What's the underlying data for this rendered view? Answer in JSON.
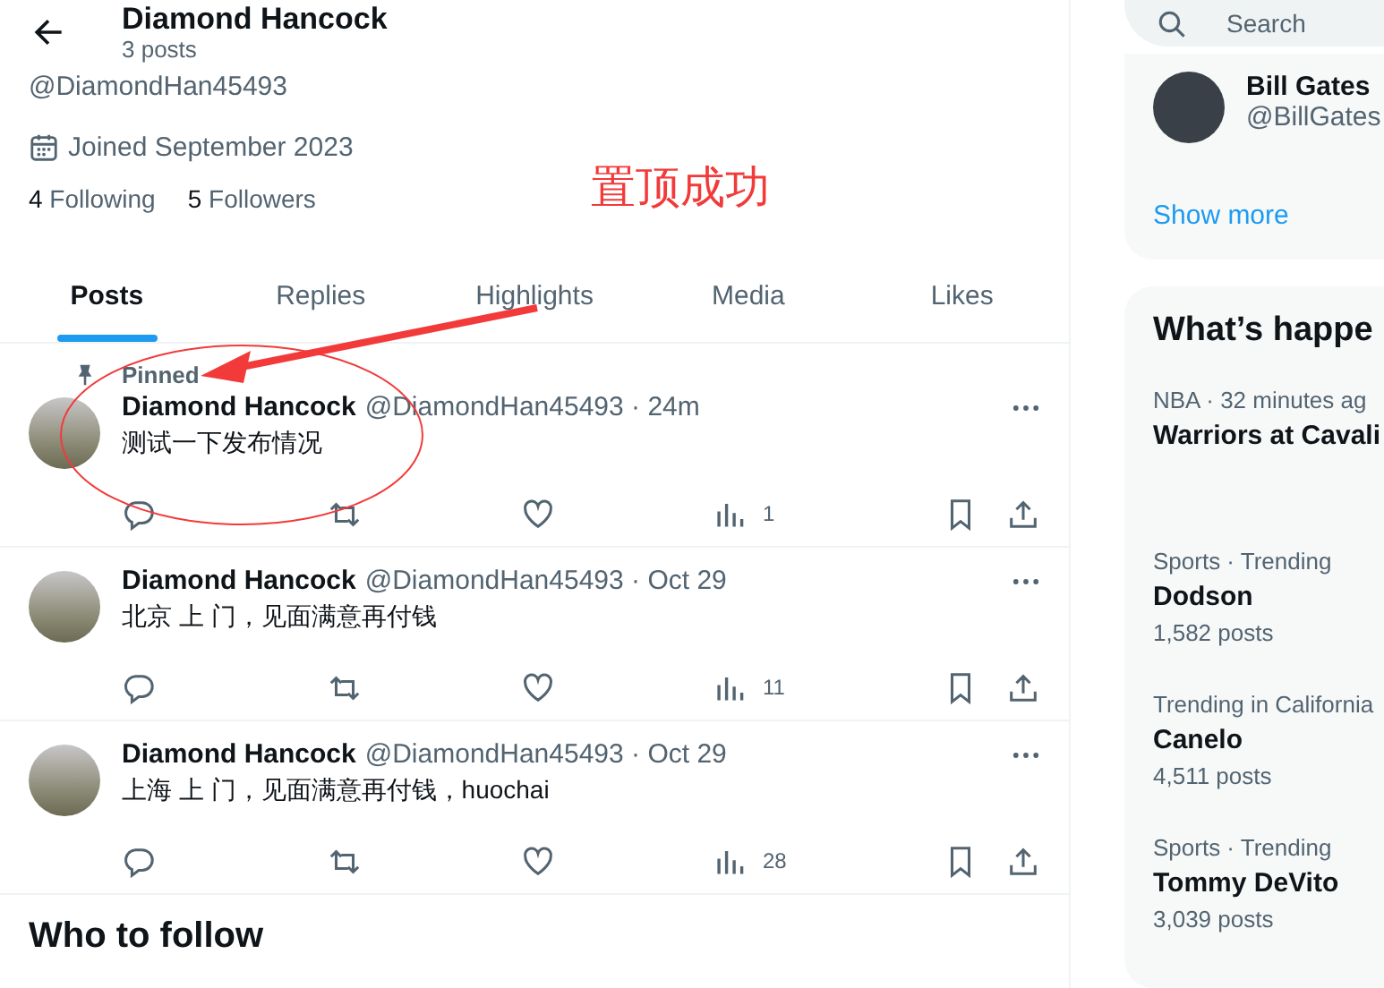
{
  "header": {
    "title": "Diamond Hancock",
    "subtitle": "3 posts"
  },
  "profile": {
    "handle": "@DiamondHan45493",
    "joined": "Joined September 2023",
    "following_count": "4",
    "following_label": "Following",
    "followers_count": "5",
    "followers_label": "Followers"
  },
  "annotation": {
    "text": "置顶成功"
  },
  "tabs": [
    {
      "label": "Posts",
      "selected": true
    },
    {
      "label": "Replies",
      "selected": false
    },
    {
      "label": "Highlights",
      "selected": false
    },
    {
      "label": "Media",
      "selected": false
    },
    {
      "label": "Likes",
      "selected": false
    }
  ],
  "posts": [
    {
      "pinned": true,
      "pinned_label": "Pinned",
      "name": "Diamond Hancock",
      "handle_time": "@DiamondHan45493 · 24m",
      "text": "测试一下发布情况",
      "views": "1"
    },
    {
      "pinned": false,
      "name": "Diamond Hancock",
      "handle_time": "@DiamondHan45493 · Oct 29",
      "text": "北京 上 门，见面满意再付钱",
      "views": "11"
    },
    {
      "pinned": false,
      "name": "Diamond Hancock",
      "handle_time": "@DiamondHan45493 · Oct 29",
      "text": "上海 上 门，见面满意再付钱，huochai",
      "views": "28"
    }
  ],
  "who_to_follow": {
    "title": "Who to follow"
  },
  "sidebar": {
    "search": {
      "placeholder": "Search"
    },
    "suggestion": {
      "name": "Bill Gates",
      "handle": "@BillGates"
    },
    "show_more": "Show more",
    "trends_title": "What’s happe",
    "trends": [
      {
        "context": "NBA · 32 minutes ag",
        "title": "Warriors at Cavali"
      },
      {
        "context": "Sports · Trending",
        "title": "Dodson",
        "count": "1,582 posts"
      },
      {
        "context": "Trending in California",
        "title": "Canelo",
        "count": "4,511 posts"
      },
      {
        "context": "Sports · Trending",
        "title": "Tommy DeVito",
        "count": "3,039 posts"
      }
    ]
  }
}
